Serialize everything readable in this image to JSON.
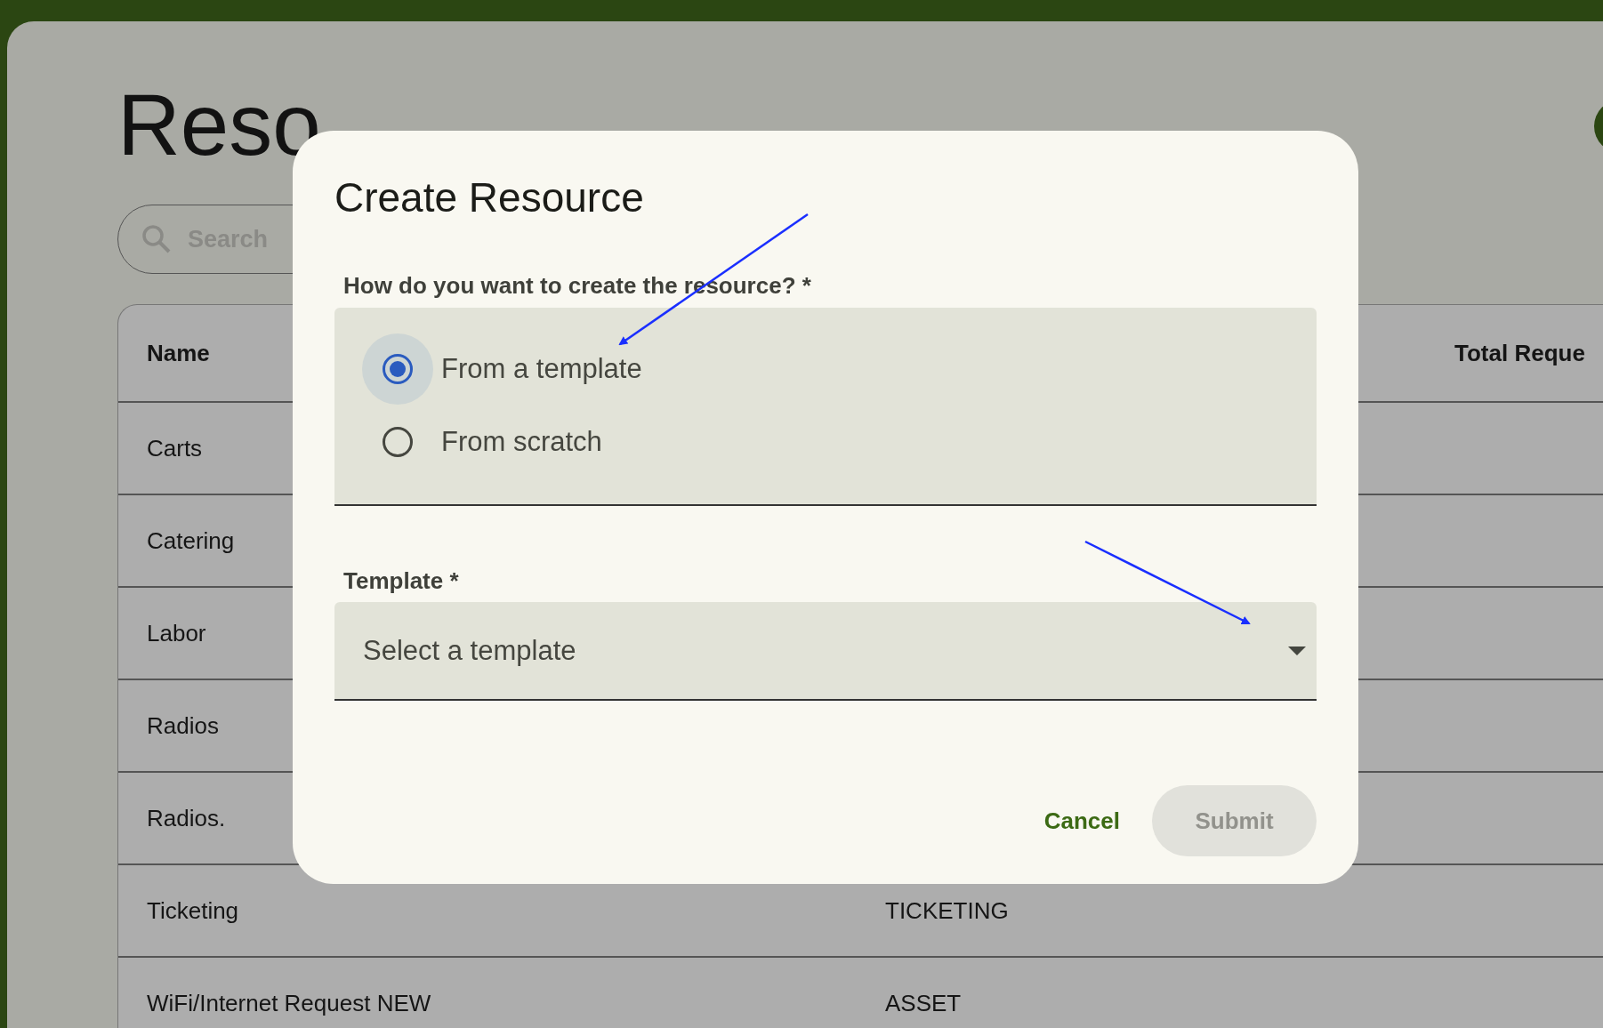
{
  "page": {
    "title": "Reso",
    "search": {
      "placeholder": "Search"
    }
  },
  "table": {
    "header": {
      "name": "Name",
      "column_3": "Total Reque"
    },
    "rows": [
      {
        "name": "Carts"
      },
      {
        "name": "Catering"
      },
      {
        "name": "Labor"
      },
      {
        "name": "Radios"
      },
      {
        "name": "Radios."
      },
      {
        "name": "Ticketing",
        "column_2": "TICKETING"
      },
      {
        "name": "WiFi/Internet Request NEW",
        "column_2": "ASSET"
      }
    ]
  },
  "dialog": {
    "title": "Create Resource",
    "method": {
      "label": "How do you want to create the resource? *",
      "options": [
        {
          "label": "From a template",
          "selected": true
        },
        {
          "label": "From scratch",
          "selected": false
        }
      ]
    },
    "template": {
      "label": "Template *",
      "placeholder": "Select a template"
    },
    "buttons": [
      {
        "label": "Cancel",
        "kind": "text",
        "disabled": false
      },
      {
        "label": "Submit",
        "kind": "filled",
        "disabled": true
      }
    ]
  }
}
